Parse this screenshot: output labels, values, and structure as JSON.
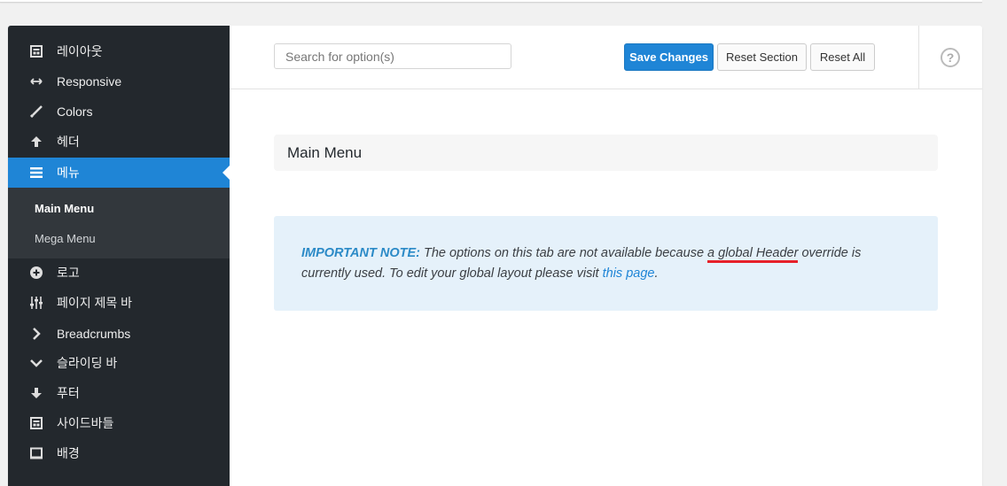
{
  "sidebar": {
    "items": [
      {
        "label": "레이아웃",
        "icon": "layout-icon"
      },
      {
        "label": "Responsive",
        "icon": "arrows-horizontal-icon"
      },
      {
        "label": "Colors",
        "icon": "brush-icon"
      },
      {
        "label": "헤더",
        "icon": "arrow-up-icon"
      },
      {
        "label": "메뉴",
        "icon": "menu-icon"
      },
      {
        "label": "로고",
        "icon": "plus-circle-icon"
      },
      {
        "label": "페이지 제목 바",
        "icon": "sliders-icon"
      },
      {
        "label": "Breadcrumbs",
        "icon": "chevron-right-icon"
      },
      {
        "label": "슬라이딩 바",
        "icon": "chevron-down-icon"
      },
      {
        "label": "푸터",
        "icon": "arrow-down-icon"
      },
      {
        "label": "사이드바들",
        "icon": "sidebar-layout-icon"
      },
      {
        "label": "배경",
        "icon": "monitor-icon"
      }
    ],
    "sub_items": [
      {
        "label": "Main Menu"
      },
      {
        "label": "Mega Menu"
      }
    ]
  },
  "toolbar": {
    "search_placeholder": "Search for option(s)",
    "save_label": "Save Changes",
    "reset_section_label": "Reset Section",
    "reset_all_label": "Reset All",
    "help_label": "?"
  },
  "main": {
    "section_title": "Main Menu",
    "notice": {
      "strong": "IMPORTANT NOTE:",
      "text1": " The options on this tab are not available because ",
      "highlight": "a global Header",
      "text2": " override is currently used. To edit your global layout please visit ",
      "link": "this page",
      "text3": "."
    }
  },
  "colors": {
    "accent": "#1f85d6",
    "sidebar_bg": "#23282d",
    "notice_bg": "#e5f1fa",
    "highlight_underline": "#e6212a"
  }
}
